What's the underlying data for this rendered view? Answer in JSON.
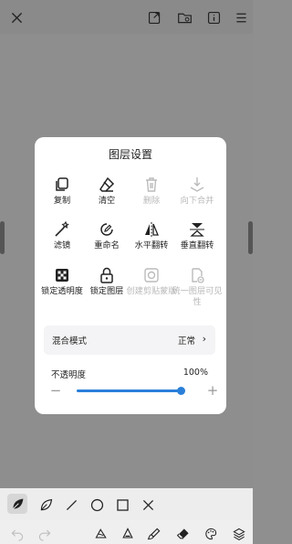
{
  "dialog": {
    "title": "图层设置",
    "items": [
      {
        "label": "复制",
        "icon": "copy-icon",
        "enabled": true
      },
      {
        "label": "清空",
        "icon": "eraser-icon",
        "enabled": true
      },
      {
        "label": "删除",
        "icon": "trash-icon",
        "enabled": false
      },
      {
        "label": "向下合并",
        "icon": "merge-down-icon",
        "enabled": false
      },
      {
        "label": "滤镜",
        "icon": "magic-wand-icon",
        "enabled": true
      },
      {
        "label": "重命名",
        "icon": "rename-icon",
        "enabled": true
      },
      {
        "label": "水平翻转",
        "icon": "flip-horizontal-icon",
        "enabled": true
      },
      {
        "label": "垂直翻转",
        "icon": "flip-vertical-icon",
        "enabled": true
      },
      {
        "label": "锁定透明度",
        "icon": "checker-lock-icon",
        "enabled": true
      },
      {
        "label": "锁定图层",
        "icon": "padlock-icon",
        "enabled": true
      },
      {
        "label": "创建剪贴蒙版",
        "icon": "clip-mask-icon",
        "enabled": false
      },
      {
        "label": "统一图层可见性",
        "icon": "visibility-sync-icon",
        "enabled": false
      }
    ],
    "blend_mode": {
      "label": "混合模式",
      "value": "正常",
      "chevron": "›"
    },
    "opacity": {
      "label": "不透明度",
      "value_text": "100%",
      "value": 1.0,
      "minus": "−",
      "plus": "+"
    }
  },
  "colors": {
    "accent": "#2a7fd9",
    "disabled": "#b8b8b8"
  }
}
